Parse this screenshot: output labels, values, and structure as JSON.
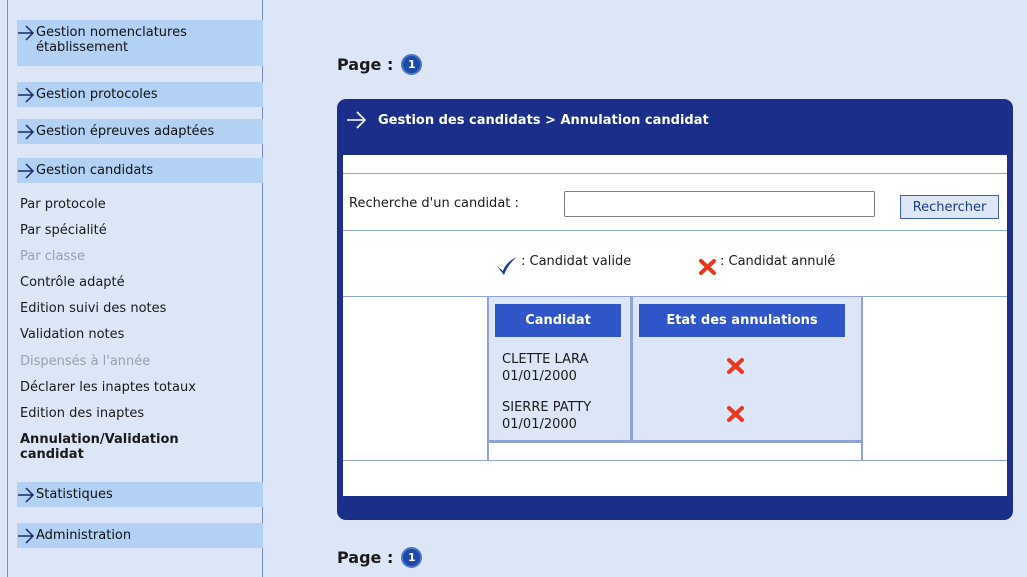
{
  "sidebar": {
    "headers": [
      {
        "line1": "Gestion nomenclatures",
        "line2": "établissement"
      },
      {
        "line1": "Gestion protocoles"
      },
      {
        "line1": "Gestion épreuves adaptées"
      },
      {
        "line1": "Gestion candidats"
      },
      {
        "line1": "Statistiques"
      },
      {
        "line1": "Administration"
      }
    ],
    "subitems": [
      {
        "label": "Par protocole",
        "state": "enabled"
      },
      {
        "label": "Par spécialité",
        "state": "enabled"
      },
      {
        "label": "Par classe",
        "state": "disabled"
      },
      {
        "label": "Contrôle adapté",
        "state": "enabled"
      },
      {
        "label": "Edition suivi des notes",
        "state": "enabled"
      },
      {
        "label": "Validation notes",
        "state": "enabled"
      },
      {
        "label": "Dispensés à l'année",
        "state": "disabled"
      },
      {
        "label": "Déclarer les inaptes totaux",
        "state": "enabled"
      },
      {
        "label": "Edition des inaptes",
        "state": "enabled"
      },
      {
        "label": "Annulation/Validation",
        "label2": "candidat",
        "state": "active"
      }
    ]
  },
  "pagination": {
    "label": "Page :",
    "page": "1"
  },
  "panel": {
    "title": "Gestion des candidats > Annulation candidat",
    "search": {
      "label": "Recherche d'un candidat :",
      "value": "",
      "placeholder": "",
      "button": "Rechercher"
    },
    "legend": {
      "valid": ": Candidat valide",
      "cancelled": ": Candidat annulé"
    },
    "table": {
      "headers": [
        "Candidat",
        "Etat des annulations"
      ],
      "rows": [
        {
          "name": "CLETTE LARA",
          "date": "01/01/2000",
          "state": "cancelled"
        },
        {
          "name": "SIERRE PATTY",
          "date": "01/01/2000",
          "state": "cancelled"
        }
      ]
    }
  },
  "colors": {
    "panel": "#1b2f8a",
    "header_button": "#2f55c8",
    "sidebar_header": "#b2d1f4",
    "background": "#dce6f7",
    "cancel_icon": "#e8381b",
    "valid_icon": "#1a3a9a"
  },
  "icons": {
    "nav": "arrow-right-icon",
    "valid": "checkmark-icon",
    "cancelled": "cross-icon",
    "page": "page-number-badge"
  }
}
